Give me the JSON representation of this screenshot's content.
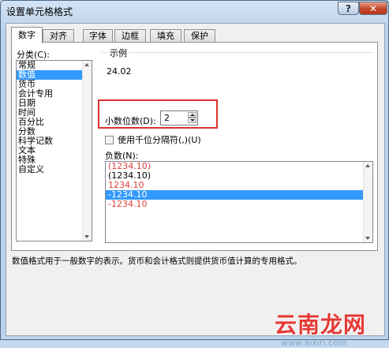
{
  "window": {
    "title": "设置单元格格式",
    "help": "?",
    "close": "✕"
  },
  "tabs": [
    {
      "label": "数字",
      "active": true
    },
    {
      "label": "对齐",
      "active": false
    },
    {
      "label": "字体",
      "active": false
    },
    {
      "label": "边框",
      "active": false
    },
    {
      "label": "填充",
      "active": false
    },
    {
      "label": "保护",
      "active": false
    }
  ],
  "category": {
    "label": "分类(C):",
    "items": [
      "常规",
      "数值",
      "货币",
      "会计专用",
      "日期",
      "时间",
      "百分比",
      "分数",
      "科学记数",
      "文本",
      "特殊",
      "自定义"
    ],
    "selected_index": 1
  },
  "sample": {
    "caption": "示例",
    "value": "24.02"
  },
  "decimal": {
    "label": "小数位数(D):",
    "value": "2"
  },
  "thousands": {
    "label": "使用千位分隔符(,)(U)",
    "checked": false
  },
  "negative": {
    "label": "负数(N):",
    "items": [
      {
        "text": "(1234.10)",
        "red": true
      },
      {
        "text": "(1234.10)",
        "red": false
      },
      {
        "text": "1234.10",
        "red": true
      },
      {
        "text": "-1234.10",
        "red": false,
        "selected": true
      },
      {
        "text": "-1234.10",
        "red": true
      }
    ]
  },
  "description": "数值格式用于一般数字的表示。货币和会计格式则提供货币值计算的专用格式。",
  "watermark": {
    "text": "云南龙网",
    "url": "www.aixiri.com"
  },
  "colors": {
    "highlight": "#e0302c",
    "selection": "#3399ff",
    "negative_red": "#e03c3c"
  }
}
